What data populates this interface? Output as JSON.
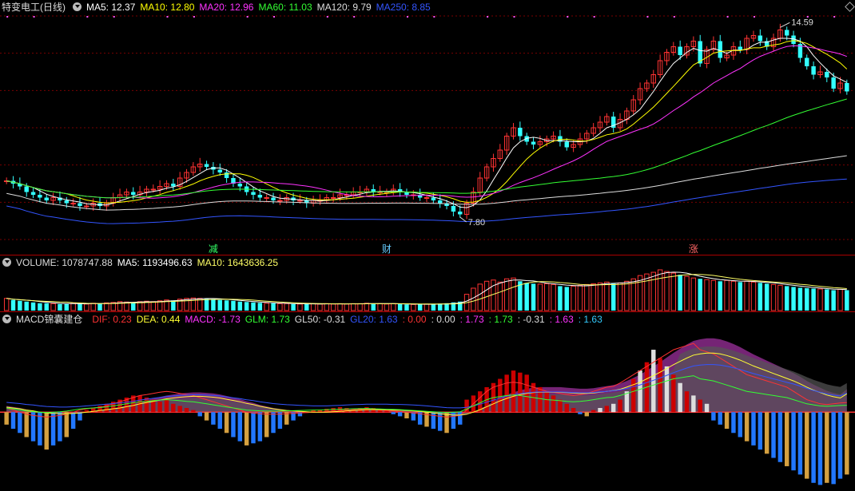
{
  "header": {
    "title": "特变电工(日线)",
    "ma": [
      {
        "label": "MA5: 12.37",
        "color": "#ffffff"
      },
      {
        "label": "MA10: 12.80",
        "color": "#ffff00"
      },
      {
        "label": "MA20: 12.96",
        "color": "#ff33ff"
      },
      {
        "label": "MA60: 11.03",
        "color": "#33ff33"
      },
      {
        "label": "MA120: 9.79",
        "color": "#dddddd"
      },
      {
        "label": "MA250: 8.85",
        "color": "#3355ff"
      }
    ]
  },
  "volume_header": [
    {
      "label": "VOLUME: 1078747.88",
      "color": "#dddddd"
    },
    {
      "label": "MA5: 1193496.63",
      "color": "#ffffff"
    },
    {
      "label": "MA10: 1643636.25",
      "color": "#ffff66"
    }
  ],
  "macd_header": {
    "name": "MACD锦囊建仓",
    "items": [
      {
        "label": "DIF: 0.23",
        "color": "#ff3333"
      },
      {
        "label": "DEA: 0.44",
        "color": "#ffff33"
      },
      {
        "label": "MACD: -1.73",
        "color": "#ff33ff"
      },
      {
        "label": "GLM: 1.73",
        "color": "#33ff33"
      },
      {
        "label": "GL50: -0.31",
        "color": "#dddddd"
      },
      {
        "label": "GL20: 1.63",
        "color": "#3355ff"
      },
      {
        "label": ": 0.00",
        "color": "#ff3333"
      },
      {
        "label": ": 0.00",
        "color": "#dddddd"
      },
      {
        "label": ": 1.73",
        "color": "#ff33ff"
      },
      {
        "label": ": 1.73",
        "color": "#33ff33"
      },
      {
        "label": ": -0.31",
        "color": "#dddddd"
      },
      {
        "label": ": 1.63",
        "color": "#ff33ff"
      },
      {
        "label": ": 1.63",
        "color": "#33ccff"
      }
    ]
  },
  "annotations": {
    "high_label": "14.59",
    "low_label": "7.80",
    "markers": [
      {
        "label": "减",
        "color": "#33ff66"
      },
      {
        "label": "财",
        "color": "#66ccff"
      },
      {
        "label": "涨",
        "color": "#ff6666"
      }
    ]
  },
  "chart_data": {
    "type": "candlestick",
    "price_range": [
      7.0,
      15.0
    ],
    "high": 14.59,
    "low": 7.8,
    "closes": [
      9.1,
      9.0,
      8.9,
      8.7,
      8.6,
      8.5,
      8.4,
      8.5,
      8.4,
      8.3,
      8.3,
      8.2,
      8.2,
      8.3,
      8.2,
      8.3,
      8.5,
      8.6,
      8.7,
      8.6,
      8.7,
      8.8,
      8.8,
      8.9,
      9.0,
      8.9,
      9.2,
      9.4,
      9.6,
      9.7,
      9.6,
      9.5,
      9.4,
      9.2,
      9.0,
      8.9,
      8.7,
      8.6,
      8.5,
      8.5,
      8.4,
      8.4,
      8.5,
      8.4,
      8.4,
      8.3,
      8.4,
      8.4,
      8.5,
      8.5,
      8.6,
      8.6,
      8.7,
      8.7,
      8.8,
      8.7,
      8.7,
      8.7,
      8.8,
      8.7,
      8.6,
      8.6,
      8.5,
      8.5,
      8.4,
      8.3,
      8.2,
      8.0,
      7.9,
      8.3,
      8.7,
      9.2,
      9.6,
      9.9,
      10.2,
      10.7,
      11.0,
      10.7,
      10.5,
      10.4,
      10.5,
      10.6,
      10.7,
      10.5,
      10.3,
      10.4,
      10.6,
      10.8,
      11.0,
      11.2,
      11.4,
      11.0,
      11.3,
      11.6,
      12.0,
      12.4,
      12.6,
      12.9,
      13.4,
      13.7,
      13.9,
      13.6,
      13.9,
      14.1,
      13.3,
      13.8,
      14.1,
      13.5,
      13.6,
      13.9,
      13.8,
      14.2,
      14.3,
      14.1,
      13.9,
      14.2,
      14.5,
      14.3,
      14.0,
      13.5,
      13.2,
      12.9,
      13.0,
      12.8,
      12.4,
      12.6,
      12.3
    ],
    "volume": [
      30,
      26,
      24,
      22,
      20,
      18,
      18,
      17,
      16,
      16,
      18,
      17,
      16,
      18,
      17,
      19,
      20,
      22,
      21,
      20,
      22,
      23,
      22,
      24,
      26,
      25,
      28,
      30,
      31,
      30,
      29,
      28,
      26,
      25,
      24,
      22,
      21,
      20,
      19,
      18,
      18,
      17,
      17,
      16,
      16,
      16,
      17,
      16,
      17,
      16,
      17,
      16,
      17,
      17,
      18,
      17,
      17,
      16,
      17,
      16,
      15,
      15,
      15,
      16,
      16,
      17,
      18,
      20,
      22,
      40,
      55,
      65,
      72,
      75,
      70,
      78,
      80,
      72,
      68,
      66,
      65,
      66,
      64,
      60,
      58,
      60,
      62,
      64,
      66,
      68,
      70,
      66,
      68,
      72,
      78,
      86,
      90,
      94,
      100,
      96,
      92,
      88,
      84,
      80,
      78,
      76,
      74,
      72,
      74,
      72,
      70,
      72,
      70,
      68,
      66,
      64,
      62,
      60,
      58,
      56,
      55,
      54,
      53,
      52,
      50,
      52,
      50
    ],
    "macd_range": [
      -1.8,
      2.0
    ],
    "dif": [
      0.1,
      0.05,
      0.0,
      -0.05,
      -0.08,
      -0.1,
      -0.12,
      -0.1,
      -0.08,
      -0.05,
      0.0,
      0.05,
      0.08,
      0.1,
      0.12,
      0.15,
      0.2,
      0.25,
      0.3,
      0.35,
      0.4,
      0.42,
      0.45,
      0.48,
      0.5,
      0.48,
      0.45,
      0.42,
      0.4,
      0.35,
      0.3,
      0.25,
      0.2,
      0.15,
      0.1,
      0.05,
      0.0,
      -0.02,
      -0.04,
      -0.05,
      -0.05,
      -0.05,
      -0.04,
      -0.03,
      -0.02,
      -0.01,
      0.0,
      0.0,
      0.02,
      0.03,
      0.04,
      0.05,
      0.06,
      0.07,
      0.08,
      0.06,
      0.05,
      0.04,
      0.03,
      0.02,
      0.0,
      -0.02,
      -0.04,
      -0.06,
      -0.08,
      -0.1,
      -0.12,
      -0.1,
      -0.08,
      0.05,
      0.2,
      0.35,
      0.5,
      0.6,
      0.65,
      0.7,
      0.72,
      0.7,
      0.65,
      0.6,
      0.55,
      0.5,
      0.48,
      0.45,
      0.42,
      0.4,
      0.42,
      0.45,
      0.5,
      0.55,
      0.6,
      0.62,
      0.7,
      0.8,
      0.9,
      1.0,
      1.1,
      1.2,
      1.3,
      1.4,
      1.5,
      1.55,
      1.6,
      1.65,
      1.5,
      1.45,
      1.4,
      1.3,
      1.2,
      1.1,
      1.0,
      0.9,
      0.85,
      0.8,
      0.75,
      0.7,
      0.65,
      0.6,
      0.5,
      0.4,
      0.3,
      0.25,
      0.2,
      0.18,
      0.2,
      0.22,
      0.23
    ],
    "dea": [
      0.12,
      0.1,
      0.08,
      0.05,
      0.03,
      0.0,
      -0.02,
      -0.03,
      -0.04,
      -0.04,
      -0.03,
      -0.02,
      0.0,
      0.02,
      0.04,
      0.06,
      0.08,
      0.1,
      0.13,
      0.16,
      0.2,
      0.23,
      0.26,
      0.29,
      0.32,
      0.34,
      0.36,
      0.37,
      0.38,
      0.38,
      0.37,
      0.36,
      0.34,
      0.31,
      0.28,
      0.25,
      0.21,
      0.18,
      0.14,
      0.11,
      0.08,
      0.06,
      0.04,
      0.03,
      0.02,
      0.01,
      0.0,
      0.0,
      0.0,
      0.01,
      0.02,
      0.03,
      0.04,
      0.05,
      0.06,
      0.06,
      0.06,
      0.06,
      0.05,
      0.05,
      0.04,
      0.03,
      0.02,
      0.0,
      -0.02,
      -0.04,
      -0.06,
      -0.07,
      -0.07,
      -0.05,
      0.0,
      0.06,
      0.13,
      0.2,
      0.27,
      0.33,
      0.38,
      0.42,
      0.45,
      0.47,
      0.48,
      0.48,
      0.48,
      0.48,
      0.47,
      0.46,
      0.45,
      0.45,
      0.46,
      0.48,
      0.5,
      0.52,
      0.55,
      0.6,
      0.66,
      0.72,
      0.8,
      0.88,
      0.96,
      1.05,
      1.14,
      1.22,
      1.3,
      1.37,
      1.4,
      1.42,
      1.42,
      1.4,
      1.36,
      1.31,
      1.25,
      1.18,
      1.11,
      1.05,
      0.99,
      0.93,
      0.87,
      0.81,
      0.75,
      0.68,
      0.6,
      0.53,
      0.47,
      0.41,
      0.37,
      0.34,
      0.44
    ],
    "macd": [
      -0.3,
      -0.4,
      -0.5,
      -0.6,
      -0.7,
      -0.8,
      -0.9,
      -0.8,
      -0.7,
      -0.6,
      -0.4,
      -0.2,
      0.05,
      0.1,
      0.15,
      0.2,
      0.25,
      0.3,
      0.35,
      0.4,
      0.4,
      0.35,
      0.3,
      0.25,
      0.3,
      0.2,
      0.15,
      0.1,
      0.05,
      -0.1,
      -0.2,
      -0.3,
      -0.4,
      -0.5,
      -0.6,
      -0.7,
      -0.8,
      -0.75,
      -0.7,
      -0.6,
      -0.5,
      -0.4,
      -0.3,
      -0.2,
      -0.1,
      0.0,
      0.05,
      0.06,
      0.08,
      0.1,
      0.12,
      0.1,
      0.08,
      0.1,
      0.12,
      0.1,
      0.08,
      0.05,
      -0.05,
      -0.1,
      -0.15,
      -0.2,
      -0.3,
      -0.35,
      -0.4,
      -0.45,
      -0.5,
      -0.4,
      -0.3,
      0.3,
      0.4,
      0.5,
      0.6,
      0.7,
      0.8,
      0.9,
      1.0,
      0.95,
      0.9,
      0.7,
      0.6,
      0.5,
      0.4,
      0.3,
      0.2,
      0.1,
      -0.05,
      -0.1,
      0.05,
      0.1,
      0.15,
      0.2,
      0.3,
      0.5,
      0.8,
      1.0,
      1.2,
      1.5,
      1.3,
      1.1,
      0.9,
      0.7,
      0.5,
      0.4,
      0.3,
      0.2,
      -0.2,
      -0.3,
      -0.4,
      -0.5,
      -0.6,
      -0.7,
      -0.8,
      -0.9,
      -1.0,
      -1.1,
      -1.2,
      -1.3,
      -1.4,
      -1.5,
      -1.6,
      -1.7,
      -1.75,
      -1.7,
      -1.73,
      -1.6,
      -1.5
    ]
  }
}
